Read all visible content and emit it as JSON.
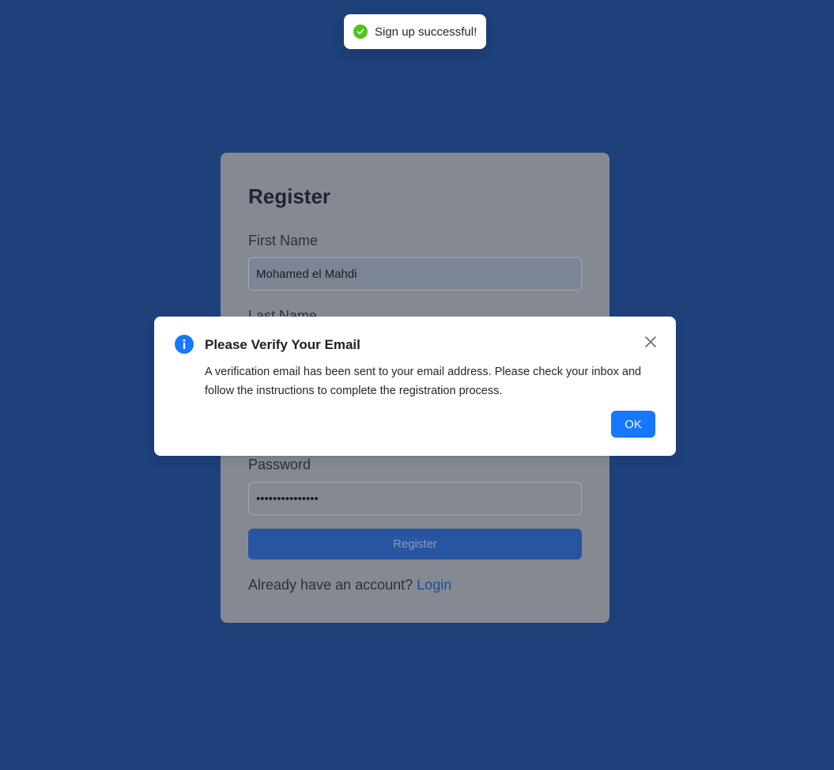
{
  "toast": {
    "icon": "check-circle-icon",
    "message": "Sign up successful!",
    "color": "#52c41a"
  },
  "register": {
    "title": "Register",
    "first_name_label": "First Name",
    "first_name_value": "Mohamed el Mahdi",
    "last_name_label": "Last Name",
    "password_label": "Password",
    "password_value": "•••••••••••••••",
    "register_button": "Register",
    "login_prompt": "Already have an account?",
    "login_link": "Login"
  },
  "modal": {
    "icon": "info-circle-icon",
    "title": "Please Verify Your Email",
    "body": "A verification email has been sent to your email address. Please check your inbox and follow the instructions to complete the registration process.",
    "ok_label": "OK",
    "close_icon": "close-icon",
    "accent_color": "#1677ff"
  },
  "colors": {
    "page_background": "#1e407b",
    "overlay_card": "#858a92",
    "button_primary": "#1677ff"
  }
}
